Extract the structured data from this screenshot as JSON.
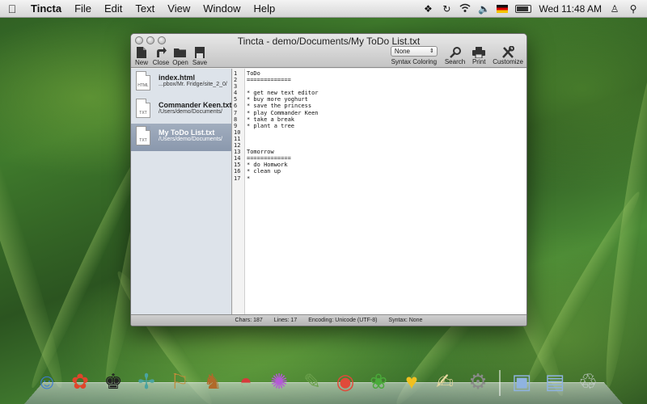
{
  "menubar": {
    "app_name": "Tincta",
    "items": [
      "File",
      "Edit",
      "Text",
      "View",
      "Window",
      "Help"
    ],
    "clock": "Wed 11:48 AM",
    "icons": [
      "apple-icon",
      "dropbox-icon",
      "sync-icon",
      "wifi-icon",
      "volume-icon",
      "flag-icon",
      "battery-icon",
      "user-icon"
    ]
  },
  "window": {
    "title": "Tincta - demo/Documents/My ToDo List.txt",
    "toolbar": {
      "new": "New",
      "close": "Close",
      "open": "Open",
      "save": "Save",
      "syntax_value": "None",
      "syntax_label": "Syntax Coloring",
      "search": "Search",
      "print": "Print",
      "customize": "Customize"
    },
    "files": [
      {
        "name": "index.html",
        "path": "...pbox/Mr. Fridge/site_2_0/",
        "tag": "HTML"
      },
      {
        "name": "Commander Keen.txt",
        "path": "/Users/demo/Documents/",
        "tag": "TXT"
      },
      {
        "name": "My ToDo List.txt",
        "path": "/Users/demo/Documents/",
        "tag": "TXT"
      }
    ],
    "lines": [
      "ToDo",
      "=============",
      "",
      "* get new text editor",
      "* buy more yoghurt",
      "* save the princess",
      "* play Commander Keen",
      "* take a break",
      "* plant a tree",
      "",
      "",
      "",
      "Tomorrow",
      "=============",
      "* do Homwork",
      "* clean up",
      "*"
    ],
    "line_numbers": [
      "1",
      "2",
      "3",
      "4",
      "5",
      "6",
      "7",
      "8",
      "9",
      "10",
      "11",
      "12",
      "13",
      "14",
      "15",
      "16",
      "17"
    ],
    "status": {
      "chars": "Chars: 187",
      "lines": "Lines: 17",
      "encoding": "Encoding: Unicode (UTF-8)",
      "syntax": "Syntax: None"
    }
  },
  "dock": {
    "apps": [
      {
        "name": "finder-icon",
        "glyph": "☺"
      },
      {
        "name": "flower-app-icon",
        "glyph": "✿"
      },
      {
        "name": "tuxedo-app-icon",
        "glyph": "♚"
      },
      {
        "name": "dragonfly-app-icon",
        "glyph": "✢"
      },
      {
        "name": "director-chair-app-icon",
        "glyph": "⚐"
      },
      {
        "name": "kangaroo-app-icon",
        "glyph": "♞"
      },
      {
        "name": "watermelon-app-icon",
        "glyph": "◓"
      },
      {
        "name": "octopus-app-icon",
        "glyph": "✺"
      },
      {
        "name": "tasks-app-icon",
        "glyph": "✎"
      },
      {
        "name": "chrome-icon",
        "glyph": "◉"
      },
      {
        "name": "frog-app-icon",
        "glyph": "❀"
      },
      {
        "name": "duck-app-icon",
        "glyph": "♥"
      },
      {
        "name": "textedit-icon",
        "glyph": "✍"
      },
      {
        "name": "system-preferences-icon",
        "glyph": "⚙"
      }
    ],
    "folders": [
      {
        "name": "applications-folder-icon",
        "glyph": "▣"
      },
      {
        "name": "documents-folder-icon",
        "glyph": "▤"
      },
      {
        "name": "trash-icon",
        "glyph": "♲"
      }
    ],
    "colors": {
      "finder": "#3b7bd6",
      "flower": "#e0452b",
      "tuxedo": "#222222",
      "dragonfly": "#4aa3a0",
      "chair": "#c28c3a",
      "kangaroo": "#b06a2a",
      "watermelon": "#d63a3a",
      "octopus": "#b45ad6",
      "tasks": "#6aa04a",
      "chrome": "#e04a3a",
      "frog": "#4aaa3a",
      "duck": "#f0c020",
      "textedit": "#e8d9a0",
      "sysprefs": "#8a8a8a",
      "folder": "#8fb3e0",
      "trash": "#cfd4d8"
    }
  }
}
